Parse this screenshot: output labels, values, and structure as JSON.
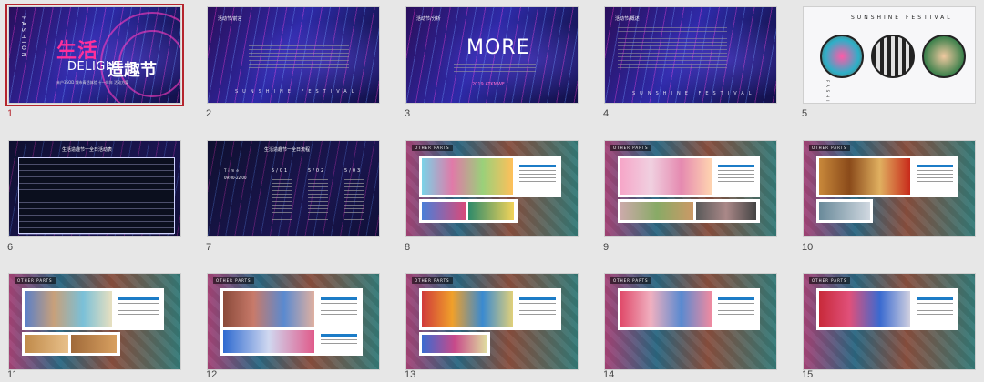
{
  "slides": [
    {
      "num": "1",
      "vertical_text": "FASHION",
      "title_cn": "生活",
      "title_en": "DELIGHT",
      "title_cn2": "造趣节",
      "subtitle": "未户3SOD 城市青活体验 十一年年 活动方案"
    },
    {
      "num": "2",
      "label": "活动节/前言",
      "sunshine": "SUNSHINE FESTIVAL"
    },
    {
      "num": "3",
      "label": "活动节/分析",
      "more": "MORE",
      "year": "2019 ATKMWF"
    },
    {
      "num": "4",
      "label": "活动节/概述",
      "sunshine": "SUNSHINE FESTIVAL"
    },
    {
      "num": "5",
      "title": "SUNSHINE FESTIVAL",
      "vertical_text": "FASHION"
    },
    {
      "num": "6",
      "title": "生活造趣节一全日活动表"
    },
    {
      "num": "7",
      "title": "生活造趣节一全日流程",
      "times": [
        "Time",
        "09:00-22:00"
      ],
      "cols": [
        "5/01",
        "5/02",
        "5/03"
      ]
    },
    {
      "num": "8",
      "tag": "OTHER PARTS"
    },
    {
      "num": "9",
      "tag": "OTHER PARTS"
    },
    {
      "num": "10",
      "tag": "OTHER PARTS"
    },
    {
      "num": "11",
      "tag": "OTHER PARTS"
    },
    {
      "num": "12",
      "tag": "OTHER PARTS"
    },
    {
      "num": "13",
      "tag": "OTHER PARTS"
    },
    {
      "num": "14",
      "tag": "OTHER PARTS"
    },
    {
      "num": "15",
      "tag": "OTHER PARTS"
    }
  ],
  "colors": {
    "selected_border": "#b5252d",
    "accent_pink": "#ff2f9b",
    "accent_blue": "#1c7cc7"
  }
}
